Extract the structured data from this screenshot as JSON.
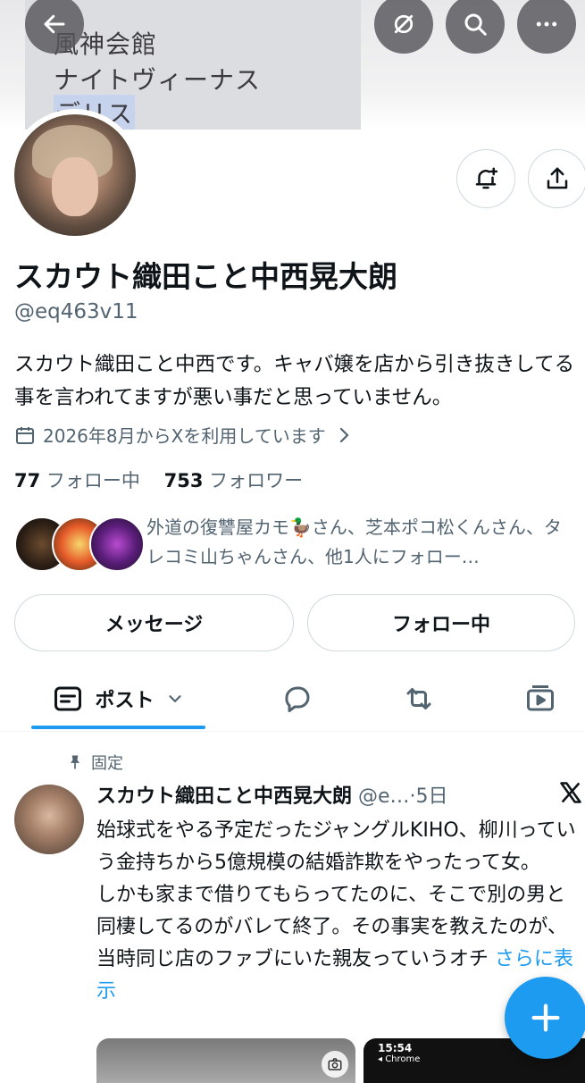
{
  "banner": {
    "lines": [
      "風神会館",
      "ナイトヴィーナス",
      "デリス"
    ]
  },
  "header_buttons": {
    "back_icon": "arrow-left-icon",
    "icons": [
      "slash-eye-icon",
      "search-icon",
      "more-icon"
    ]
  },
  "profile": {
    "name": "スカウト織田こと中西晃大朗",
    "handle": "@eq463v11",
    "bio": "スカウト織田こと中西です。キャバ嬢を店から引き抜きしてる事を言われてますが悪い事だと思っていません。",
    "joined": "2026年8月からXを利用しています",
    "following_count": "77",
    "following_label": "フォロー中",
    "followers_count": "753",
    "followers_label": "フォロワー",
    "followed_by": "外道の復讐屋カモ🦆さん、芝本ポコ松くんさん、タレコミ山ちゃんさん、他1人にフォロー…"
  },
  "actions": {
    "message": "メッセージ",
    "following": "フォロー中"
  },
  "tabs": {
    "posts_label": "ポスト"
  },
  "post": {
    "pinned_label": "固定",
    "author": "スカウト織田こと中西晃大朗",
    "meta": "@e…·5日",
    "text": "始球式をやる予定だったジャングルKIHO、柳川っていう金持ちから5億規模の結婚詐欺をやったって女。\nしかも家まで借りてもらってたのに、そこで別の男と同棲してるのがバレて終了。その事実を教えたのが、当時同じ店のファブにいた親友っていうオチ ",
    "more": "さらに表示"
  },
  "media": {
    "time": "15:54",
    "app": "◂ Chrome"
  },
  "colors": {
    "accent": "#1d9bf0",
    "muted": "#536471",
    "text": "#0f1419"
  }
}
